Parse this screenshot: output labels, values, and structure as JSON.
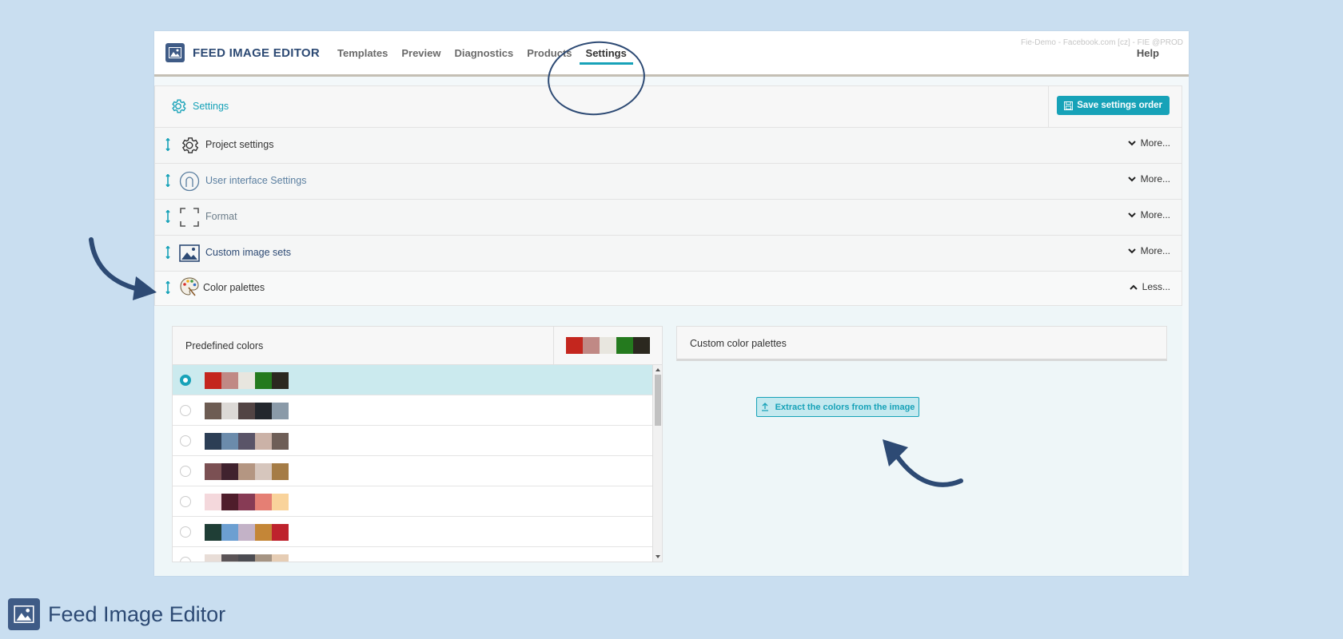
{
  "brand": {
    "app_name": "FEED IMAGE EDITOR",
    "footer_name": "Feed Image Editor",
    "color": "#3f5b86"
  },
  "nav": {
    "items": [
      {
        "label": "Templates",
        "active": false
      },
      {
        "label": "Preview",
        "active": false
      },
      {
        "label": "Diagnostics",
        "active": false
      },
      {
        "label": "Products",
        "active": false
      },
      {
        "label": "Settings",
        "active": true
      }
    ],
    "env": "Fie-Demo - Facebook.com [cz] - FIE @PROD",
    "help": "Help"
  },
  "settings": {
    "title": "Settings",
    "save_label": "Save settings order",
    "accent": "#17a2b8",
    "rows": [
      {
        "label": "Project settings",
        "icon": "gear-icon",
        "toggle": "More...",
        "expanded": false
      },
      {
        "label": "User interface Settings",
        "icon": "user-circle-icon",
        "toggle": "More...",
        "expanded": false
      },
      {
        "label": "Format",
        "icon": "frame-corners-icon",
        "toggle": "More...",
        "expanded": false
      },
      {
        "label": "Custom image sets",
        "icon": "image-icon",
        "toggle": "More...",
        "expanded": false
      },
      {
        "label": "Color palettes",
        "icon": "palette-icon",
        "toggle": "Less...",
        "expanded": true
      }
    ]
  },
  "palettes": {
    "predefined_title": "Predefined colors",
    "selected_colors": [
      "#c4261e",
      "#c08985",
      "#e8e6df",
      "#247a1e",
      "#2b281f"
    ],
    "rows": [
      {
        "colors": [
          "#c4261e",
          "#c08985",
          "#e8e6df",
          "#247a1e",
          "#2b281f"
        ],
        "selected": true
      },
      {
        "colors": [
          "#6d5c53",
          "#dcd9d6",
          "#524444",
          "#23272d",
          "#8a9aa8"
        ],
        "selected": false
      },
      {
        "colors": [
          "#2c3e55",
          "#6b8bab",
          "#5a5468",
          "#cbb2a7",
          "#6e5e57"
        ],
        "selected": false
      },
      {
        "colors": [
          "#7b5053",
          "#40222e",
          "#b49682",
          "#d6c6bd",
          "#a57c46"
        ],
        "selected": false
      },
      {
        "colors": [
          "#f4d8dc",
          "#4f1d2b",
          "#873b55",
          "#e57f74",
          "#f9d39b"
        ],
        "selected": false
      },
      {
        "colors": [
          "#1f3e36",
          "#6c9fd1",
          "#c3b2c7",
          "#c48637",
          "#be232d"
        ],
        "selected": false
      },
      {
        "colors": [
          "#e8ddd7",
          "#5b5457",
          "#4c4c52",
          "#a59483",
          "#e6cdb4"
        ],
        "selected": false
      }
    ],
    "custom_title": "Custom color palettes",
    "extract_label": "Extract the colors from the image"
  }
}
